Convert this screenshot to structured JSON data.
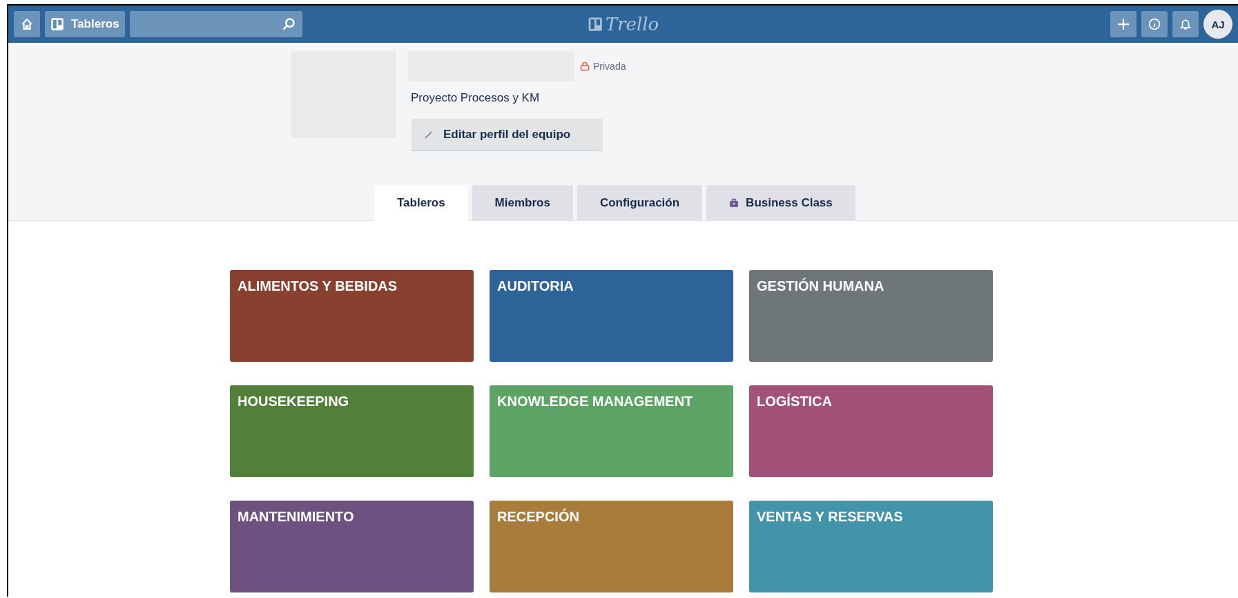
{
  "header": {
    "boards_button": "Tableros",
    "logo": "Trello",
    "avatar": "AJ"
  },
  "team": {
    "visibility": "Privada",
    "description": "Proyecto Procesos y KM",
    "edit_button": "Editar perfil del equipo"
  },
  "tabs": [
    {
      "label": "Tableros",
      "selected": true,
      "kind": "plain"
    },
    {
      "label": "Miembros",
      "selected": false,
      "kind": "plain"
    },
    {
      "label": "Configuración",
      "selected": false,
      "kind": "plain"
    },
    {
      "label": "Business Class",
      "selected": false,
      "kind": "business"
    }
  ],
  "boards": [
    {
      "title": "ALIMENTOS Y BEBIDAS",
      "color": "#89412f"
    },
    {
      "title": "AUDITORIA",
      "color": "#2c6399"
    },
    {
      "title": "GESTIÓN HUMANA",
      "color": "#6f7679"
    },
    {
      "title": "HOUSEKEEPING",
      "color": "#52803b"
    },
    {
      "title": "KNOWLEDGE MANAGEMENT",
      "color": "#5ba466"
    },
    {
      "title": "LOGÍSTICA",
      "color": "#a25279"
    },
    {
      "title": "MANTENIMIENTO",
      "color": "#6d5180"
    },
    {
      "title": "RECEPCIÓN",
      "color": "#a87c3b"
    },
    {
      "title": "VENTAS Y RESERVAS",
      "color": "#4294aa"
    }
  ]
}
